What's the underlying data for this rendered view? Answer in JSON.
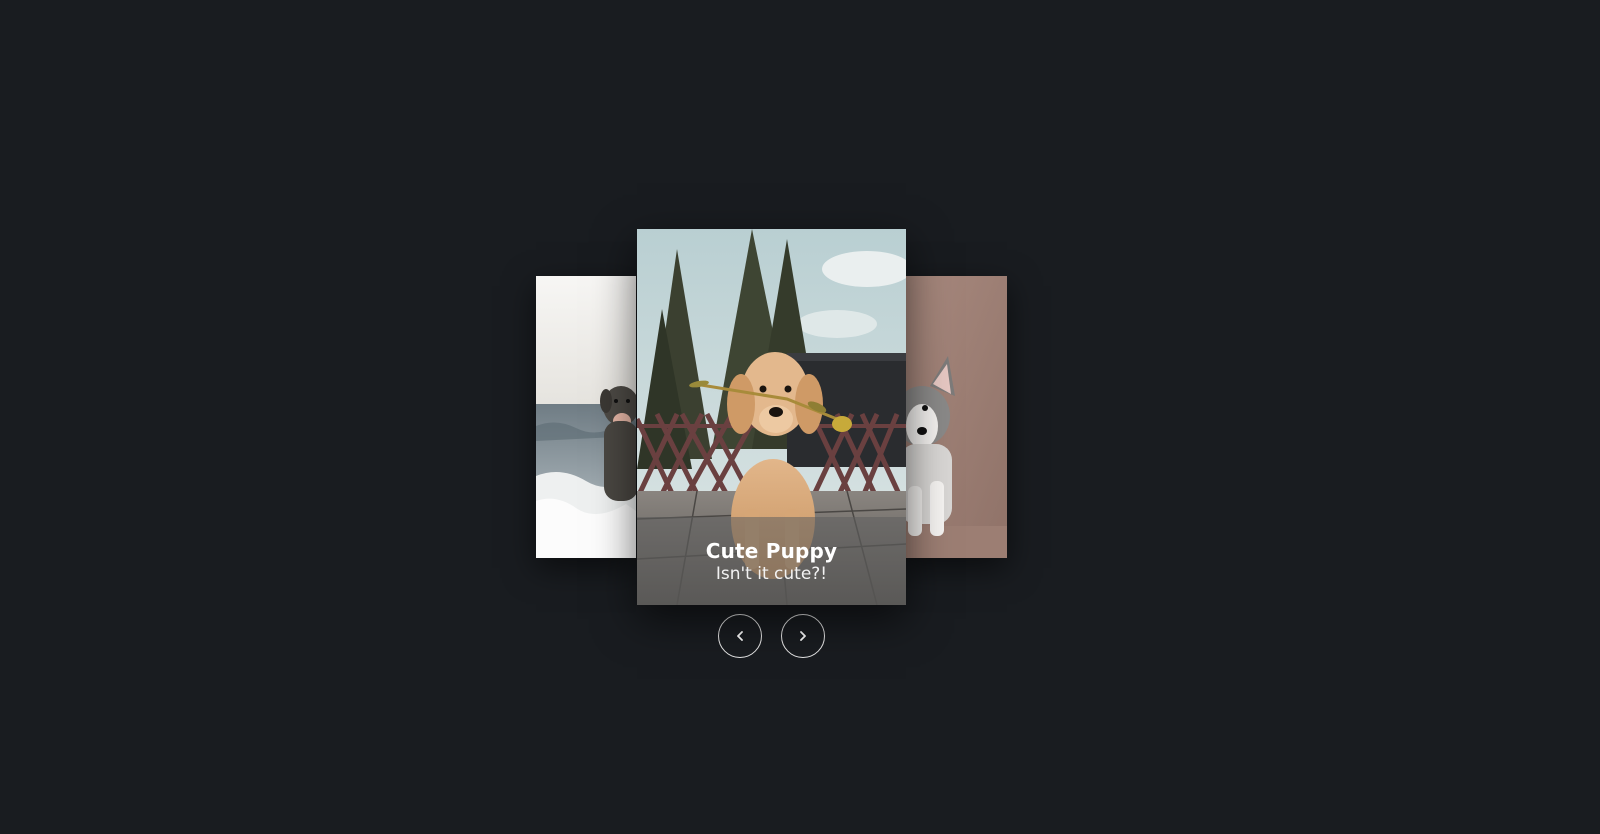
{
  "carousel": {
    "slides": [
      {
        "id": "left",
        "subject": "dog by the sea"
      },
      {
        "id": "center",
        "subject": "golden puppy with flower",
        "title": "Cute Puppy",
        "subtitle": "Isn't it cute?!"
      },
      {
        "id": "right",
        "subject": "corgi puppy"
      }
    ],
    "active_title": "Cute Puppy",
    "active_subtitle": "Isn't it cute?!",
    "prev_icon": "chevron-left-icon",
    "next_icon": "chevron-right-icon"
  },
  "colors": {
    "background": "#191c20",
    "button_border": "#e8e8e8",
    "caption_overlay": "rgba(95,95,95,0.55)"
  }
}
